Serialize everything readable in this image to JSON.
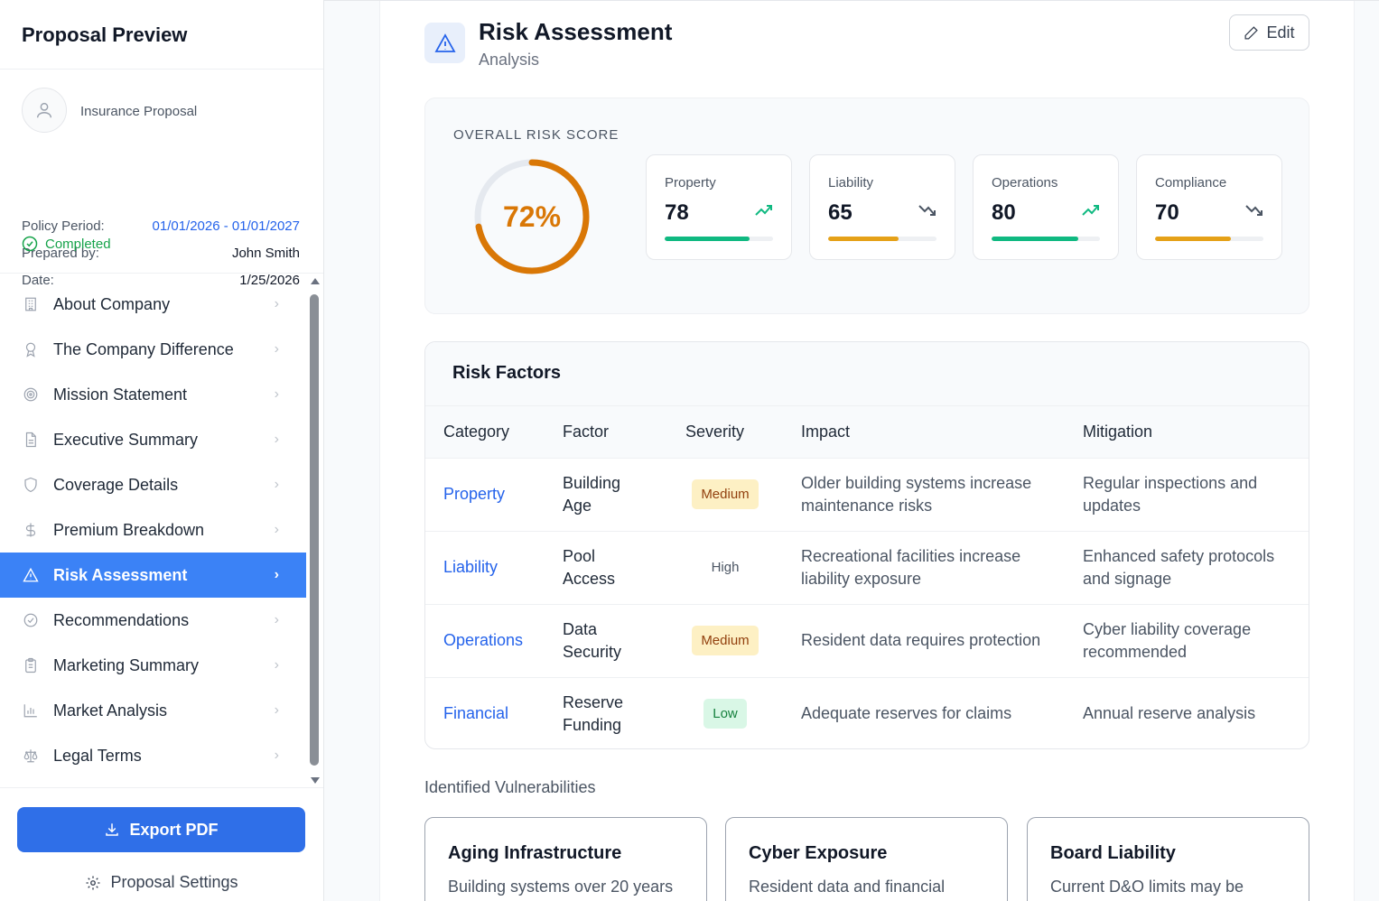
{
  "sidebar": {
    "title": "Proposal Preview",
    "proposal_type": "Insurance Proposal",
    "policy_period_label": "Policy Period:",
    "policy_period_value": "01/01/2026 - 01/01/2027",
    "prepared_by_label": "Prepared by:",
    "prepared_by_value": "John Smith",
    "date_label": "Date:",
    "date_value": "1/25/2026",
    "status": "Completed",
    "nav_items": [
      {
        "label": "About Company",
        "icon": "building-icon"
      },
      {
        "label": "The Company Difference",
        "icon": "award-icon"
      },
      {
        "label": "Mission Statement",
        "icon": "target-icon"
      },
      {
        "label": "Executive Summary",
        "icon": "document-icon"
      },
      {
        "label": "Coverage Details",
        "icon": "shield-icon"
      },
      {
        "label": "Premium Breakdown",
        "icon": "dollar-icon"
      },
      {
        "label": "Risk Assessment",
        "icon": "warning-icon",
        "active": true
      },
      {
        "label": "Recommendations",
        "icon": "check-circle-icon"
      },
      {
        "label": "Marketing Summary",
        "icon": "clipboard-icon"
      },
      {
        "label": "Market Analysis",
        "icon": "bar-chart-icon"
      },
      {
        "label": "Legal Terms",
        "icon": "scale-icon"
      }
    ],
    "export_label": "Export PDF",
    "settings_label": "Proposal Settings"
  },
  "section": {
    "title": "Risk Assessment",
    "subtitle": "Analysis",
    "edit_label": "Edit"
  },
  "score": {
    "label": "OVERALL RISK SCORE",
    "value": 72,
    "display": "72%",
    "color": "#d97706",
    "metrics": [
      {
        "name": "Property",
        "value": 78,
        "display": "78",
        "trend": "up",
        "color": "#10b981"
      },
      {
        "name": "Liability",
        "value": 65,
        "display": "65",
        "trend": "down",
        "color": "#e5a118"
      },
      {
        "name": "Operations",
        "value": 80,
        "display": "80",
        "trend": "up",
        "color": "#10b981"
      },
      {
        "name": "Compliance",
        "value": 70,
        "display": "70",
        "trend": "down",
        "color": "#e5a118"
      }
    ]
  },
  "factors": {
    "title": "Risk Factors",
    "headers": {
      "category": "Category",
      "factor": "Factor",
      "severity": "Severity",
      "impact": "Impact",
      "mitigation": "Mitigation"
    },
    "rows": [
      {
        "category": "Property",
        "factor": "Building Age",
        "severity": "Medium",
        "level": "medium",
        "impact": "Older building systems increase maintenance risks",
        "mitigation": "Regular inspections and updates"
      },
      {
        "category": "Liability",
        "factor": "Pool Access",
        "severity": "High",
        "level": "high",
        "impact": "Recreational facilities increase liability exposure",
        "mitigation": "Enhanced safety protocols and signage"
      },
      {
        "category": "Operations",
        "factor": "Data Security",
        "severity": "Medium",
        "level": "medium",
        "impact": "Resident data requires protection",
        "mitigation": "Cyber liability coverage recommended"
      },
      {
        "category": "Financial",
        "factor": "Reserve Funding",
        "severity": "Low",
        "level": "low",
        "impact": "Adequate reserves for claims",
        "mitigation": "Annual reserve analysis"
      }
    ]
  },
  "vulnerabilities": {
    "label": "Identified Vulnerabilities",
    "cards": [
      {
        "title": "Aging Infrastructure",
        "desc": "Building systems over 20 years"
      },
      {
        "title": "Cyber Exposure",
        "desc": "Resident data and financial"
      },
      {
        "title": "Board Liability",
        "desc": "Current D&O limits may be"
      }
    ]
  }
}
